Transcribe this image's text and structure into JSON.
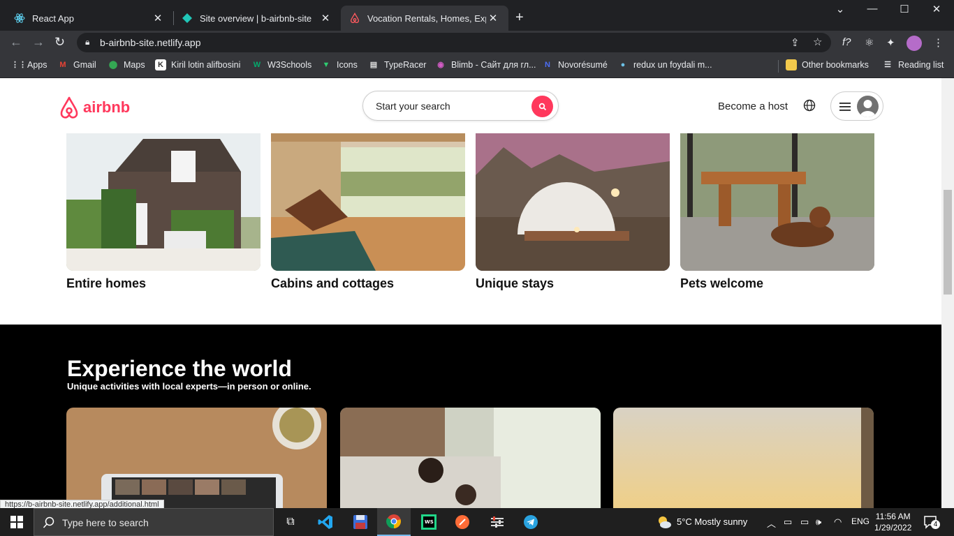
{
  "browser": {
    "tabs": [
      {
        "title": "React App",
        "active": false
      },
      {
        "title": "Site overview | b-airbnb-site",
        "active": false
      },
      {
        "title": "Vocation Rentals, Homes, Experie",
        "active": true
      }
    ],
    "url": "b-airbnb-site.netlify.app",
    "bookmarks": [
      {
        "label": "Apps"
      },
      {
        "label": "Gmail"
      },
      {
        "label": "Maps"
      },
      {
        "label": "Kiril lotin alifbosini"
      },
      {
        "label": "W3Schools"
      },
      {
        "label": "Icons"
      },
      {
        "label": "TypeRacer"
      },
      {
        "label": "Blimb - Сайт для гл..."
      },
      {
        "label": "Novorésumé"
      },
      {
        "label": "redux un foydali m..."
      },
      {
        "label": "Other bookmarks"
      },
      {
        "label": "Reading list"
      }
    ],
    "status_url": "https://b-airbnb-site.netlify.app/additional.html"
  },
  "header": {
    "logo_text": "airbnb",
    "search_placeholder": "Start your search",
    "host_label": "Become a host"
  },
  "categories": [
    {
      "label": "Entire homes"
    },
    {
      "label": "Cabins and cottages"
    },
    {
      "label": "Unique stays"
    },
    {
      "label": "Pets welcome"
    }
  ],
  "experience": {
    "title": "Experience the world",
    "subtitle": "Unique activities with local experts—in person or online."
  },
  "taskbar": {
    "search_placeholder": "Type here to search",
    "weather": "5°C  Mostly sunny",
    "lang": "ENG",
    "time": "11:56 AM",
    "date": "1/29/2022",
    "notifications": "4"
  },
  "colors": {
    "brand": "#ff385c",
    "chrome_dark": "#202124",
    "chrome_mid": "#35363a"
  }
}
